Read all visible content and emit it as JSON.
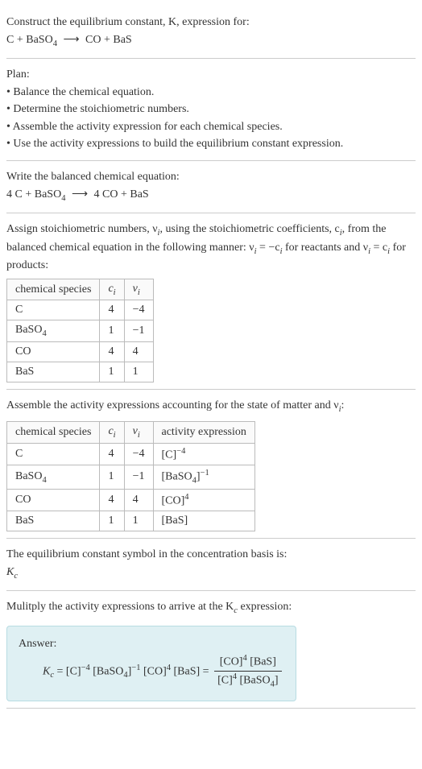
{
  "header": {
    "line1": "Construct the equilibrium constant, K, expression for:",
    "eq_lhs": "C + BaSO",
    "eq_sub1": "4",
    "eq_arrow": "⟶",
    "eq_rhs": "CO + BaS"
  },
  "plan": {
    "title": "Plan:",
    "items": [
      "• Balance the chemical equation.",
      "• Determine the stoichiometric numbers.",
      "• Assemble the activity expression for each chemical species.",
      "• Use the activity expressions to build the equilibrium constant expression."
    ]
  },
  "balanced": {
    "title": "Write the balanced chemical equation:",
    "lhs_a": "4 C + BaSO",
    "lhs_sub": "4",
    "arrow": "⟶",
    "rhs": "4 CO + BaS"
  },
  "stoich": {
    "intro1": "Assign stoichiometric numbers, ν",
    "intro1_sub": "i",
    "intro1b": ", using the stoichiometric coefficients, c",
    "intro1b_sub": "i",
    "intro1c": ", from the balanced chemical equation in the following manner: ν",
    "intro1c_sub": "i",
    "intro1d": " = −c",
    "intro1d_sub": "i",
    "intro1e": " for reactants and ν",
    "intro1e_sub": "i",
    "intro1f": " = c",
    "intro1f_sub": "i",
    "intro1g": " for products:",
    "h1": "chemical species",
    "h2": "c",
    "h2_sub": "i",
    "h3": "ν",
    "h3_sub": "i",
    "rows": [
      {
        "sp": "C",
        "c": "4",
        "nu": "−4"
      },
      {
        "sp": "BaSO",
        "sp_sub": "4",
        "c": "1",
        "nu": "−1"
      },
      {
        "sp": "CO",
        "c": "4",
        "nu": "4"
      },
      {
        "sp": "BaS",
        "c": "1",
        "nu": "1"
      }
    ]
  },
  "activity": {
    "intro": "Assemble the activity expressions accounting for the state of matter and ν",
    "intro_sub": "i",
    "intro_end": ":",
    "h1": "chemical species",
    "h2": "c",
    "h2_sub": "i",
    "h3": "ν",
    "h3_sub": "i",
    "h4": "activity expression",
    "rows": [
      {
        "sp": "C",
        "c": "4",
        "nu": "−4",
        "act_base": "[C]",
        "act_exp": "−4"
      },
      {
        "sp": "BaSO",
        "sp_sub": "4",
        "c": "1",
        "nu": "−1",
        "act_base": "[BaSO",
        "act_base_sub": "4",
        "act_base_end": "]",
        "act_exp": "−1"
      },
      {
        "sp": "CO",
        "c": "4",
        "nu": "4",
        "act_base": "[CO]",
        "act_exp": "4"
      },
      {
        "sp": "BaS",
        "c": "1",
        "nu": "1",
        "act_base": "[BaS]"
      }
    ]
  },
  "symbol": {
    "line": "The equilibrium constant symbol in the concentration basis is:",
    "k": "K",
    "k_sub": "c"
  },
  "mult": {
    "line": "Mulitply the activity expressions to arrive at the K",
    "line_sub": "c",
    "line_end": " expression:"
  },
  "answer": {
    "label": "Answer:",
    "k": "K",
    "k_sub": "c",
    "eq": " = [C]",
    "e1": "−4",
    "t2": " [BaSO",
    "t2_sub": "4",
    "t2_end": "]",
    "e2": "−1",
    "t3": " [CO]",
    "e3": "4",
    "t4": " [BaS] = ",
    "num_a": "[CO]",
    "num_exp": "4",
    "num_b": " [BaS]",
    "den_a": "[C]",
    "den_exp": "4",
    "den_b": " [BaSO",
    "den_sub": "4",
    "den_end": "]"
  }
}
